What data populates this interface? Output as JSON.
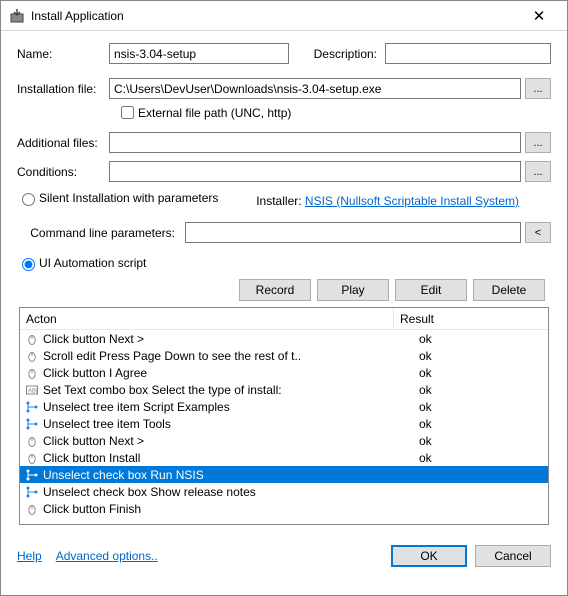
{
  "window": {
    "title": "Install Application",
    "close_glyph": "✕"
  },
  "labels": {
    "name": "Name:",
    "description": "Description:",
    "installation_file": "Installation file:",
    "external_file_path": "External file path (UNC, http)",
    "additional_files": "Additional files:",
    "conditions": "Conditions:",
    "silent_installation": "Silent Installation with parameters",
    "installer": "Installer:",
    "installer_link": "NSIS (Nullsoft Scriptable Install System)",
    "command_line_parameters": "Command line parameters:",
    "ui_automation_script": "UI Automation script",
    "record": "Record",
    "play": "Play",
    "edit": "Edit",
    "delete": "Delete",
    "col_acton": "Acton",
    "col_result": "Result",
    "help": "Help",
    "advanced_options": "Advanced options..",
    "ok": "OK",
    "cancel": "Cancel",
    "browse": "...",
    "reset": "<"
  },
  "values": {
    "name": "nsis-3.04-setup",
    "description": "",
    "installation_file": "C:\\Users\\DevUser\\Downloads\\nsis-3.04-setup.exe",
    "external_file_path_checked": false,
    "additional_files": "",
    "conditions": "",
    "installation_mode": "ui_automation",
    "command_line_parameters": ""
  },
  "grid": {
    "rows": [
      {
        "icon": "mouse",
        "action": "Click button Next >",
        "result": "ok",
        "selected": false
      },
      {
        "icon": "mouse",
        "action": "Scroll edit Press Page Down to see the rest of t..",
        "result": "ok",
        "selected": false
      },
      {
        "icon": "mouse",
        "action": "Click button I Agree",
        "result": "ok",
        "selected": false
      },
      {
        "icon": "text",
        "action": "Set Text combo box Select the type of install:",
        "result": "ok",
        "selected": false
      },
      {
        "icon": "tree",
        "action": "Unselect tree item Script Examples",
        "result": "ok",
        "selected": false
      },
      {
        "icon": "tree",
        "action": "Unselect tree item Tools",
        "result": "ok",
        "selected": false
      },
      {
        "icon": "mouse",
        "action": "Click button Next >",
        "result": "ok",
        "selected": false
      },
      {
        "icon": "mouse",
        "action": "Click button Install",
        "result": "ok",
        "selected": false
      },
      {
        "icon": "tree",
        "action": "Unselect check box Run NSIS",
        "result": "",
        "selected": true
      },
      {
        "icon": "tree",
        "action": "Unselect check box Show release notes",
        "result": "",
        "selected": false
      },
      {
        "icon": "mouse",
        "action": "Click button Finish",
        "result": "",
        "selected": false
      }
    ]
  }
}
